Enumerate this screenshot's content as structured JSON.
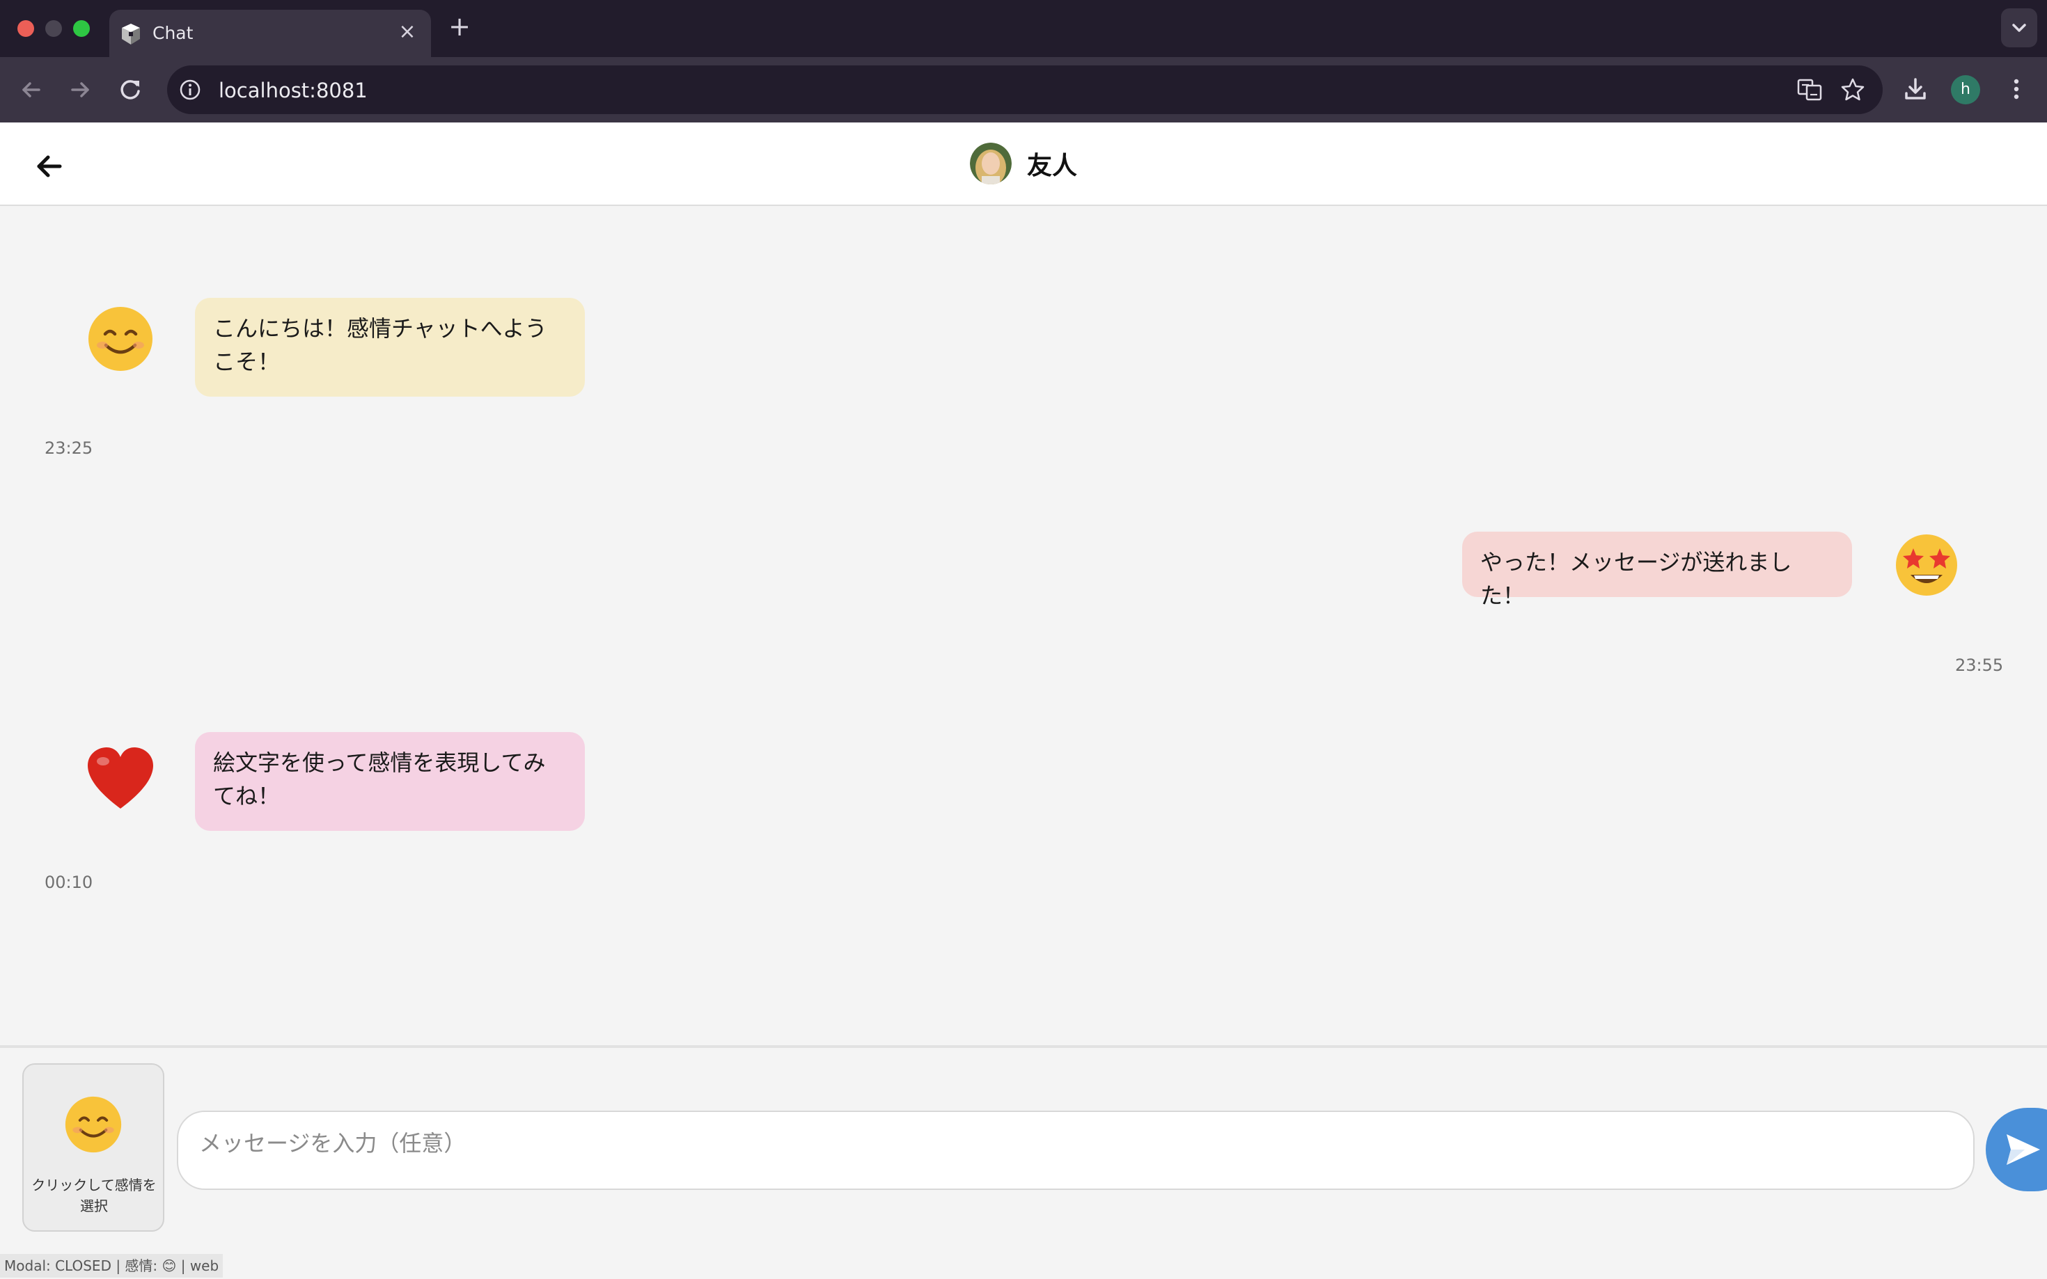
{
  "browser": {
    "tab_title": "Chat",
    "tab_close": "×",
    "new_tab": "+",
    "url": "localhost:8081",
    "profile_initial": "h"
  },
  "header": {
    "contact_name": "友人"
  },
  "messages": [
    {
      "text": "こんにちは！感情チャットへようこそ！",
      "time": "23:25",
      "emotion_icon": "smiling-face-icon",
      "side": "left",
      "bubble_color": "#f6ecc9"
    },
    {
      "text": "やった！メッセージが送れました！",
      "time": "23:55",
      "emotion_icon": "star-struck-face-icon",
      "side": "right",
      "bubble_color": "#f6d6d4"
    },
    {
      "text": "絵文字を使って感情を表現してみてね！",
      "time": "00:10",
      "emotion_icon": "red-heart-icon",
      "side": "left",
      "bubble_color": "#f5d2e3"
    }
  ],
  "composer": {
    "emotion_label": "クリックして感情を選択",
    "placeholder": "メッセージを入力（任意）"
  },
  "status_bar": "Modal: CLOSED | 感情: 😊 | web",
  "colors": {
    "accent": "#4a90d9",
    "chrome_dark": "#221c2c",
    "chrome_toolbar": "#3a3444"
  }
}
